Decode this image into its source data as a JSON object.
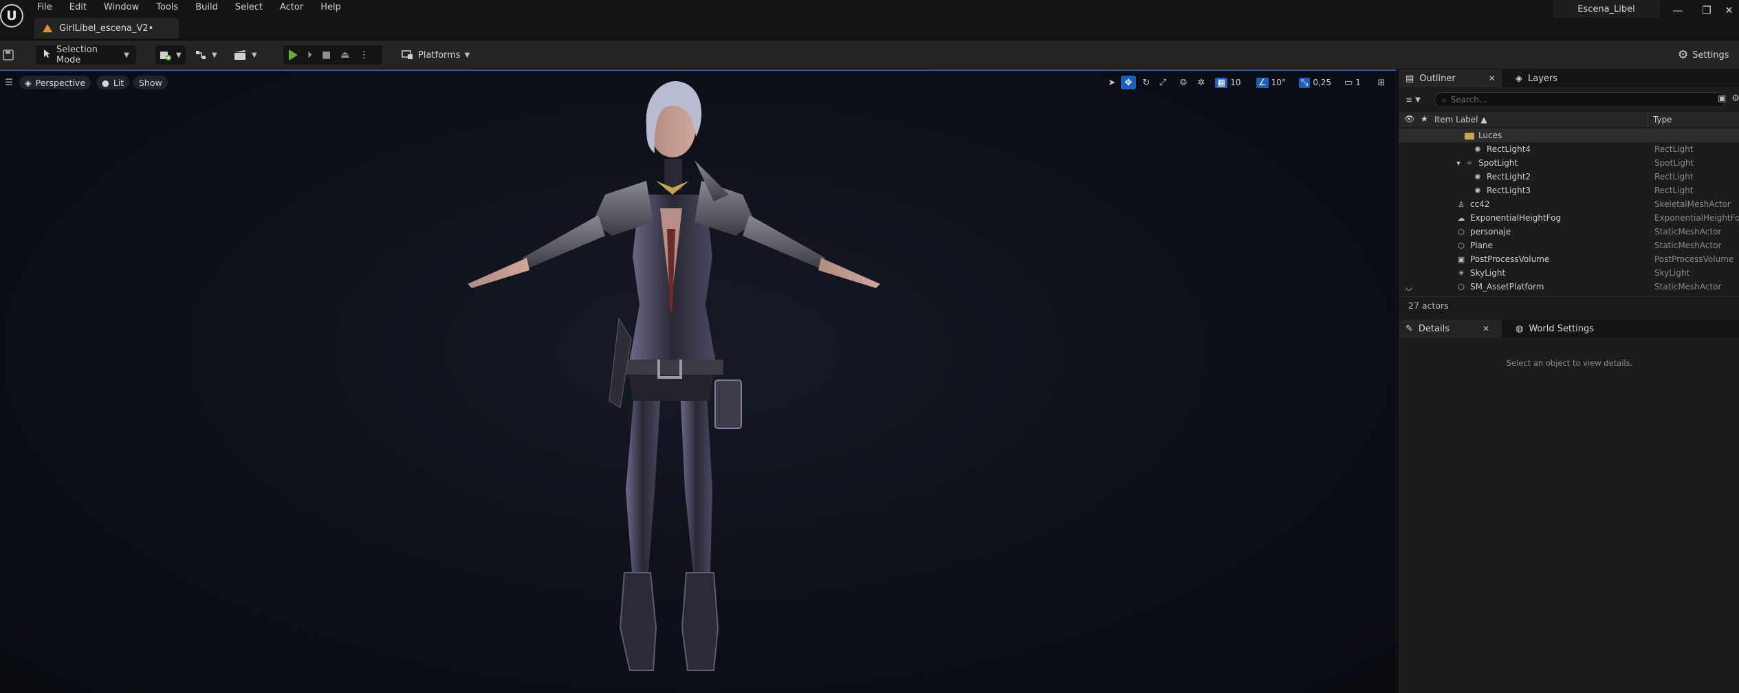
{
  "menu": [
    "File",
    "Edit",
    "Window",
    "Tools",
    "Build",
    "Select",
    "Actor",
    "Help"
  ],
  "document_tab": "GirlLibel_escena_V2•",
  "project_name": "Escena_Libel",
  "toolbar": {
    "selection_mode": "Selection Mode",
    "platforms": "Platforms",
    "settings": "Settings"
  },
  "viewport": {
    "perspective": "Perspective",
    "lit": "Lit",
    "show": "Show",
    "grid_size": "10",
    "rotation_snap": "10°",
    "scale_snap": "0,25",
    "camera_speed": "1"
  },
  "outliner": {
    "tab": "Outliner",
    "layers_tab": "Layers",
    "search_placeholder": "Search...",
    "col_label": "Item Label ▲",
    "col_type": "Type",
    "rows": [
      {
        "label": "Luces",
        "type": "",
        "icon": "folder-icon",
        "indent": 1
      },
      {
        "label": "RectLight4",
        "type": "RectLight",
        "icon": "rect-light-icon",
        "indent": 2
      },
      {
        "label": "SpotLight",
        "type": "SpotLight",
        "icon": "spot-light-icon",
        "indent": 1
      },
      {
        "label": "RectLight2",
        "type": "RectLight",
        "icon": "rect-light-icon",
        "indent": 2
      },
      {
        "label": "RectLight3",
        "type": "RectLight",
        "icon": "rect-light-icon",
        "indent": 2
      },
      {
        "label": "cc42",
        "type": "SkeletalMeshActor",
        "icon": "skeletal-mesh-icon",
        "indent": 0
      },
      {
        "label": "ExponentialHeightFog",
        "type": "ExponentialHeightFog",
        "icon": "fog-icon",
        "indent": 0
      },
      {
        "label": "personaje",
        "type": "StaticMeshActor",
        "icon": "static-mesh-icon",
        "indent": 0
      },
      {
        "label": "Plane",
        "type": "StaticMeshActor",
        "icon": "static-mesh-icon",
        "indent": 0
      },
      {
        "label": "PostProcessVolume",
        "type": "PostProcessVolume",
        "icon": "post-process-icon",
        "indent": 0
      },
      {
        "label": "SkyLight",
        "type": "SkyLight",
        "icon": "sky-light-icon",
        "indent": 0
      },
      {
        "label": "SM_AssetPlatform",
        "type": "StaticMeshActor",
        "icon": "static-mesh-icon",
        "indent": 0
      }
    ],
    "actor_count": "27 actors"
  },
  "details": {
    "tab": "Details",
    "world_settings_tab": "World Settings",
    "empty_message": "Select an object to view details."
  },
  "colors": {
    "accent": "#1b5fbf",
    "play": "#63b334",
    "folder": "#c8a352",
    "warning": "#e0902c"
  }
}
